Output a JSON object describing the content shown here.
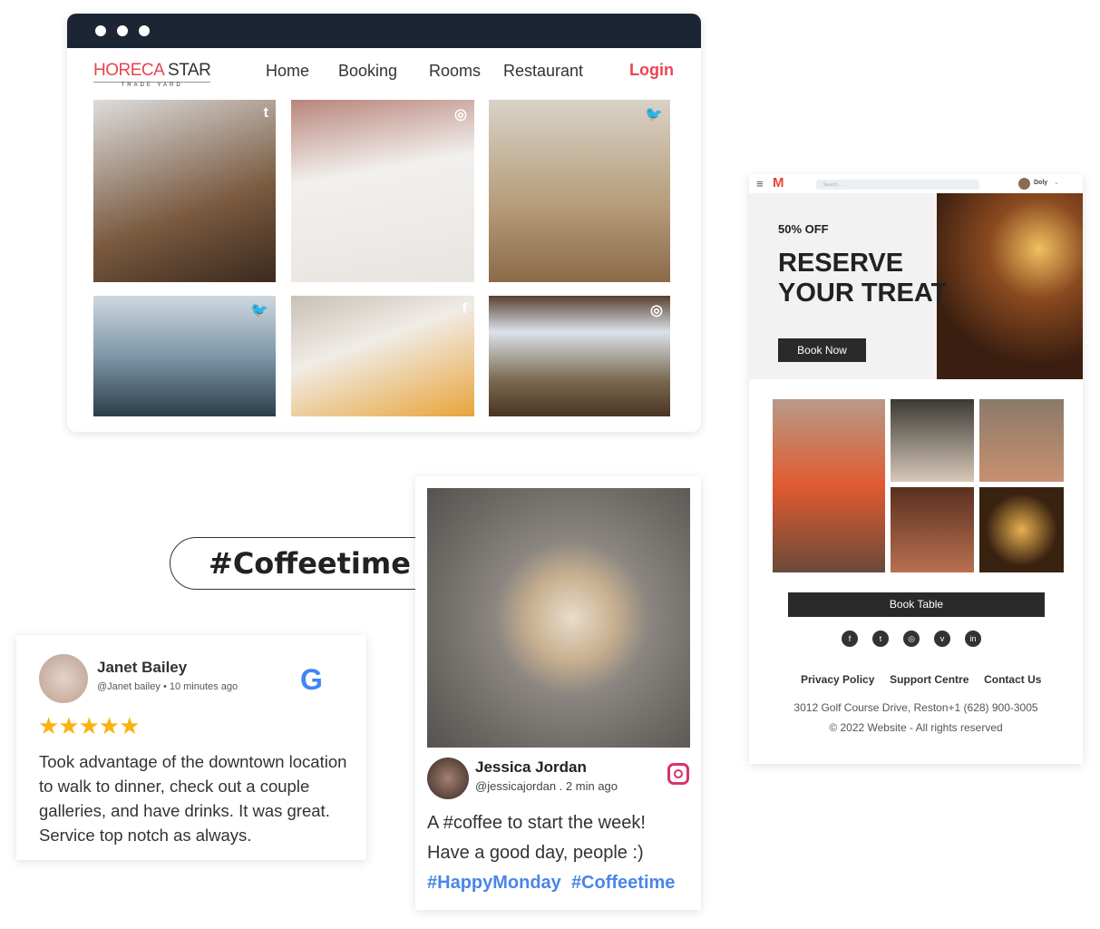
{
  "browser": {
    "logo": {
      "brand_a": "HORECA",
      "brand_b": "STAR",
      "tagline": "TRADE YARD"
    },
    "nav": [
      "Home",
      "Booking",
      "Rooms",
      "Restaurant"
    ],
    "login": "Login",
    "photos": [
      {
        "icon": "t"
      },
      {
        "icon": "◎"
      },
      {
        "icon": "🐦"
      },
      {
        "icon": "🐦"
      },
      {
        "icon": "f"
      },
      {
        "icon": "◎"
      }
    ]
  },
  "search": {
    "value": "#Coffeetime",
    "icon": "search-icon"
  },
  "review": {
    "name": "Janet Bailey",
    "handle": "@Janet bailey",
    "time": "• 10 minutes ago",
    "stars": 5,
    "rating_max": 5,
    "text": "Took advantage of the downtown location to walk to dinner, check out a couple galleries, and have drinks. It was great. Service top notch as always."
  },
  "post": {
    "name": "Jessica Jordan",
    "handle": "@jessicajordan",
    "time": ".  2 min ago",
    "line1": "A #coffee to start the week!",
    "line2": "Have a good day, people :)",
    "tags": [
      "#HappyMonday",
      "#Coffeetime"
    ]
  },
  "email": {
    "search_placeholder": "Search...",
    "user": "Doly",
    "discount": "50% OFF",
    "headline1": "RESERVE",
    "headline2": "YOUR TREAT",
    "book_now": "Book Now",
    "book_table": "Book Table",
    "socials": [
      "facebook",
      "twitter",
      "instagram",
      "vimeo",
      "linkedin"
    ],
    "links": [
      "Privacy Policy",
      "Support Centre",
      "Contact Us"
    ],
    "address": "3012 Golf Course Drive, Reston+1 (628) 900-3005",
    "copyright": "© 2022 Website - All rights reserved"
  },
  "colors": {
    "accent": "#ef4350",
    "hashtag": "#4a86e8",
    "titlebar": "#1b2533",
    "star": "#fbb20f"
  }
}
